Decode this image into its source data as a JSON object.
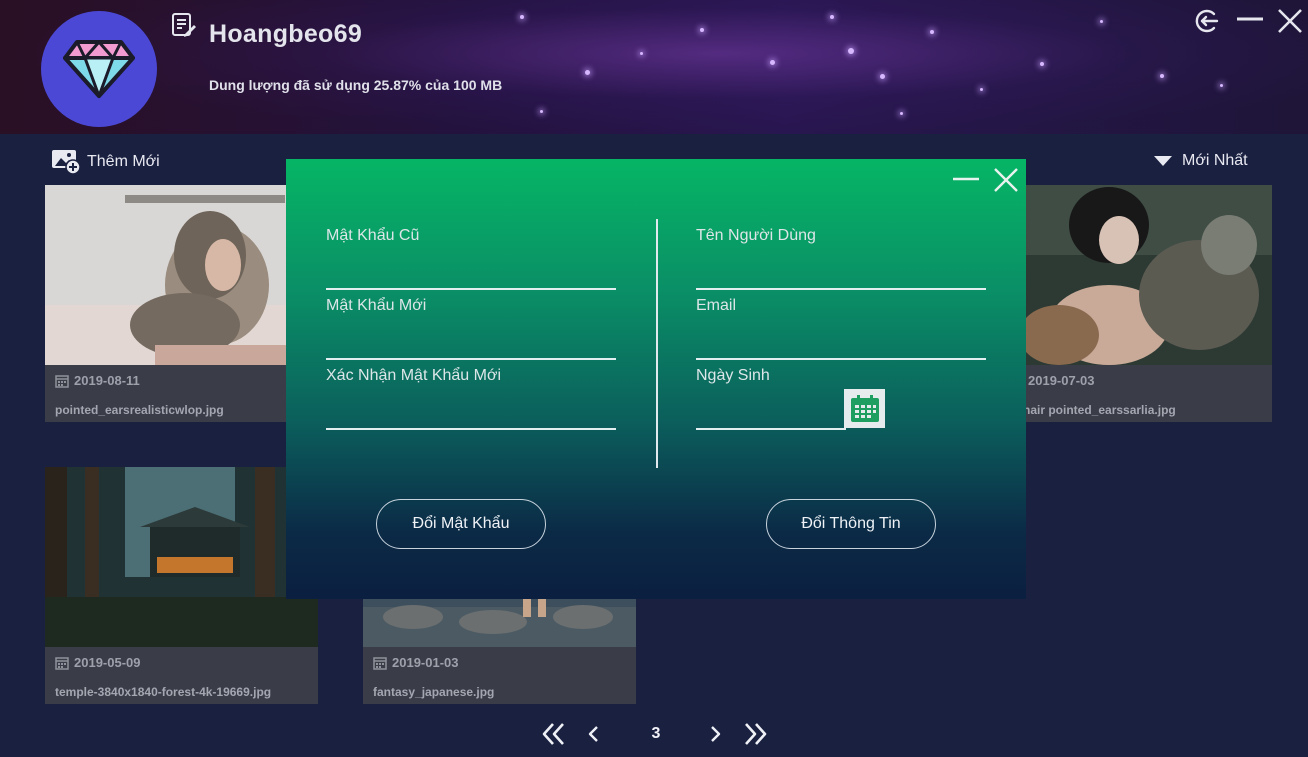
{
  "header": {
    "username": "Hoangbeo69",
    "storage_text": "Dung lượng đã sử dụng 25.87% của 100 MB"
  },
  "toolbar": {
    "add_new_label": "Thêm Mới",
    "sort_label": "Mới Nhất"
  },
  "cards": [
    {
      "date": "2019-08-11",
      "filename": "pointed_earsrealisticwlop.jpg"
    },
    {
      "date": "2019-07-03",
      "filename": "g_hair pointed_earssarlia.jpg"
    },
    {
      "date": "2019-05-09",
      "filename": "temple-3840x1840-forest-4k-19669.jpg"
    },
    {
      "date": "2019-01-03",
      "filename": "fantasy_japanese.jpg"
    }
  ],
  "pagination": {
    "current_page": "3"
  },
  "dialog": {
    "old_password_label": "Mật Khẩu Cũ",
    "new_password_label": "Mật Khẩu Mới",
    "confirm_password_label": "Xác Nhận Mật Khẩu Mới",
    "username_label": "Tên Người Dùng",
    "email_label": "Email",
    "birthday_label": "Ngày Sinh",
    "old_password_value": "",
    "new_password_value": "",
    "confirm_password_value": "",
    "username_value": "",
    "email_value": "",
    "birthday_value": "",
    "change_password_button": "Đổi Mật Khẩu",
    "change_info_button": "Đổi Thông Tin"
  },
  "colors": {
    "dialog_top": "#06b565",
    "dialog_bottom": "#0b1f40",
    "avatar_bg": "#4b48d6",
    "page_bg": "#1a2040",
    "card_footer": "#3a3d48"
  },
  "icons": {
    "avatar": "diamond-icon",
    "edit": "edit-note-icon",
    "logout": "logout-icon",
    "minimize": "minimize-icon",
    "close": "close-icon",
    "add_image": "add-image-icon",
    "sort": "triangle-down-icon",
    "date": "calendar-icon",
    "first": "double-chevron-left-icon",
    "prev": "chevron-left-icon",
    "next": "chevron-right-icon",
    "last": "double-chevron-right-icon"
  }
}
